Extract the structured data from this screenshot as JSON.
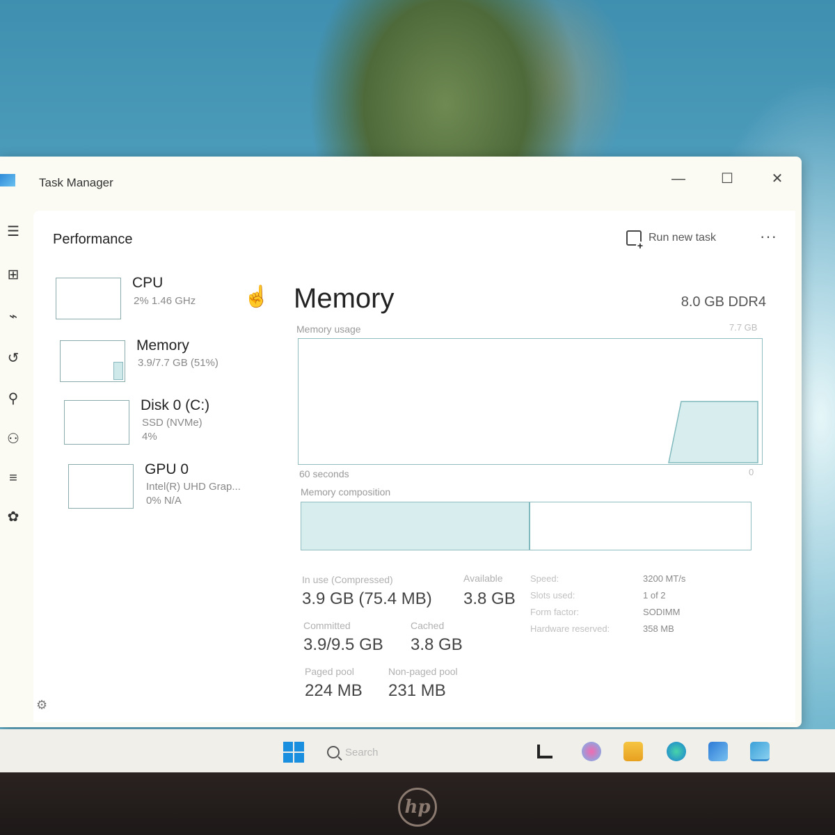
{
  "window": {
    "title": "Task Manager",
    "minimize_glyph": "—",
    "maximize_glyph": "☐",
    "close_glyph": "✕"
  },
  "header": {
    "page_title": "Performance",
    "run_new_task_label": "Run new task",
    "more_glyph": "···"
  },
  "nav_icons": [
    "hamburger-menu-icon",
    "processes-icon",
    "performance-icon",
    "app-history-icon",
    "startup-apps-icon",
    "users-icon",
    "details-icon",
    "services-icon"
  ],
  "devices": [
    {
      "name": "CPU",
      "line1": "2%  1.46 GHz",
      "line2": ""
    },
    {
      "name": "Memory",
      "line1": "3.9/7.7 GB (51%)",
      "line2": ""
    },
    {
      "name": "Disk 0 (C:)",
      "line1": "SSD (NVMe)",
      "line2": "4%"
    },
    {
      "name": "GPU 0",
      "line1": "Intel(R) UHD Grap...",
      "line2": "0%  N/A"
    }
  ],
  "memory": {
    "title": "Memory",
    "spec": "8.0 GB DDR4",
    "usage_label": "Memory usage",
    "usage_max": "7.7 GB",
    "time_label": "60 seconds",
    "time_zero": "0",
    "composition_label": "Memory composition",
    "composition_used_fraction": 0.51,
    "stats": {
      "in_use_label": "In use (Compressed)",
      "in_use_value": "3.9 GB (75.4 MB)",
      "available_label": "Available",
      "available_value": "3.8 GB",
      "committed_label": "Committed",
      "committed_value": "3.9/9.5 GB",
      "cached_label": "Cached",
      "cached_value": "3.8 GB",
      "paged_pool_label": "Paged pool",
      "paged_pool_value": "224 MB",
      "non_paged_pool_label": "Non-paged pool",
      "non_paged_pool_value": "231 MB"
    },
    "specs": {
      "speed_label": "Speed:",
      "speed_value": "3200 MT/s",
      "slots_label": "Slots used:",
      "slots_value": "1 of 2",
      "form_label": "Form factor:",
      "form_value": "SODIMM",
      "reserved_label": "Hardware reserved:",
      "reserved_value": "358 MB"
    }
  },
  "taskbar": {
    "search_placeholder": "Search"
  },
  "colors": {
    "accent": "#7fb9bd",
    "memory_fill": "#d8eeee"
  }
}
